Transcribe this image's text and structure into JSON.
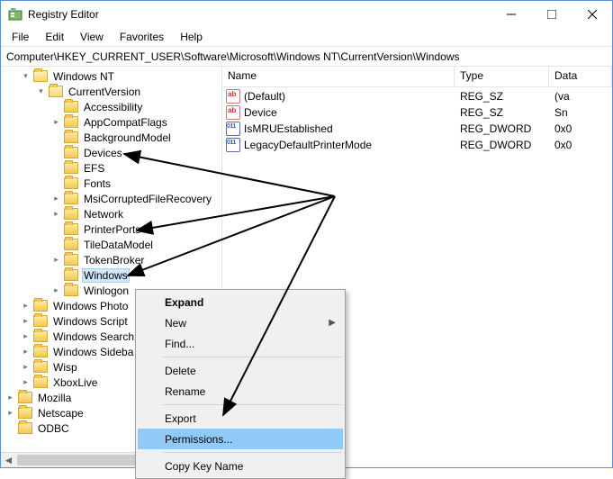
{
  "title": "Registry Editor",
  "menus": {
    "file": "File",
    "edit": "Edit",
    "view": "View",
    "favorites": "Favorites",
    "help": "Help"
  },
  "address": "Computer\\HKEY_CURRENT_USER\\Software\\Microsoft\\Windows NT\\CurrentVersion\\Windows",
  "columns": {
    "name": "Name",
    "type": "Type",
    "data": "Data"
  },
  "values": [
    {
      "name": "(Default)",
      "type": "REG_SZ",
      "data": "(va",
      "kind": "str"
    },
    {
      "name": "Device",
      "type": "REG_SZ",
      "data": "Sn",
      "kind": "str"
    },
    {
      "name": "IsMRUEstablished",
      "type": "REG_DWORD",
      "data": "0x0",
      "kind": "dw"
    },
    {
      "name": "LegacyDefaultPrinterMode",
      "type": "REG_DWORD",
      "data": "0x0",
      "kind": "dw"
    }
  ],
  "tree": {
    "winnt": "Windows NT",
    "cv": "CurrentVersion",
    "items": [
      "Accessibility",
      "AppCompatFlags",
      "BackgroundModel",
      "Devices",
      "EFS",
      "Fonts",
      "MsiCorruptedFileRecovery",
      "Network",
      "PrinterPorts",
      "TileDataModel",
      "TokenBroker",
      "Windows",
      "Winlogon"
    ],
    "siblings": [
      "Windows Photo",
      "Windows Script",
      "Windows Search",
      "Windows Sideba",
      "Wisp",
      "XboxLive"
    ],
    "after": [
      "Mozilla",
      "Netscape",
      "ODBC"
    ]
  },
  "context": {
    "expand": "Expand",
    "new": "New",
    "find": "Find...",
    "delete": "Delete",
    "rename": "Rename",
    "export": "Export",
    "permissions": "Permissions...",
    "copy": "Copy Key Name"
  }
}
